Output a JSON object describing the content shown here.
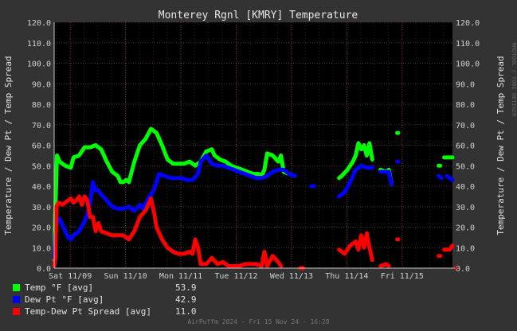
{
  "chart_data": {
    "type": "line",
    "title": "Monterey Rgnl [KMRY] Temperature",
    "ylabel": "Temperature / Dew Pt / Temp Spread",
    "right_ylabel": "Temperature / Dew Pt / Temp Spread",
    "watermark": "RRDTOOL / TOBI OETIKER",
    "ylim": [
      0,
      120
    ],
    "yticks": [
      "0.0",
      "10.0",
      "20.0",
      "30.0",
      "40.0",
      "50.0",
      "60.0",
      "70.0",
      "80.0",
      "90.0",
      "100.0",
      "110.0",
      "120.0"
    ],
    "x_range_days": [
      "Nov 08 17:00",
      "Nov 15 17:00"
    ],
    "xticks": [
      {
        "label": "Sat 11/09",
        "t": 0.29
      },
      {
        "label": "Sun 11/10",
        "t": 1.29
      },
      {
        "label": "Mon 11/11",
        "t": 2.29
      },
      {
        "label": "Tue 11/12",
        "t": 3.29
      },
      {
        "label": "Wed 11/13",
        "t": 4.29
      },
      {
        "label": "Thu 11/14",
        "t": 5.29
      },
      {
        "label": "Fri 11/15",
        "t": 6.29
      }
    ],
    "grid": true,
    "series": [
      {
        "name": "Temp °F [avg]",
        "color": "#00ff00",
        "summary": "53.9",
        "segments": [
          [
            [
              0.0,
              4
            ],
            [
              0.02,
              27
            ],
            [
              0.05,
              55
            ],
            [
              0.1,
              52
            ],
            [
              0.15,
              51
            ],
            [
              0.2,
              50
            ],
            [
              0.3,
              49
            ],
            [
              0.35,
              54
            ],
            [
              0.45,
              55
            ],
            [
              0.55,
              59
            ],
            [
              0.65,
              59
            ],
            [
              0.75,
              60
            ],
            [
              0.85,
              58
            ],
            [
              0.95,
              52
            ],
            [
              1.05,
              47
            ],
            [
              1.15,
              45
            ],
            [
              1.2,
              42
            ],
            [
              1.25,
              42
            ],
            [
              1.3,
              43
            ],
            [
              1.35,
              42
            ],
            [
              1.45,
              52
            ],
            [
              1.55,
              60
            ],
            [
              1.65,
              63
            ],
            [
              1.75,
              68
            ],
            [
              1.85,
              66
            ],
            [
              1.95,
              60
            ],
            [
              2.05,
              53
            ],
            [
              2.15,
              51
            ],
            [
              2.25,
              51
            ],
            [
              2.35,
              51
            ],
            [
              2.45,
              52
            ],
            [
              2.55,
              50
            ],
            [
              2.65,
              52
            ],
            [
              2.75,
              57
            ],
            [
              2.85,
              58
            ],
            [
              2.9,
              55
            ],
            [
              3.0,
              53
            ],
            [
              3.1,
              52
            ],
            [
              3.2,
              50
            ],
            [
              3.3,
              49
            ],
            [
              3.4,
              48
            ],
            [
              3.5,
              47
            ],
            [
              3.6,
              46
            ],
            [
              3.7,
              46
            ],
            [
              3.75,
              45
            ],
            [
              3.8,
              48
            ],
            [
              3.85,
              56
            ],
            [
              3.95,
              55
            ],
            [
              4.05,
              52
            ],
            [
              4.1,
              55
            ],
            [
              4.15,
              47
            ],
            [
              4.25,
              46
            ],
            [
              4.35,
              45
            ]
          ],
          [
            [
              5.15,
              44
            ],
            [
              5.2,
              45
            ],
            [
              5.3,
              48
            ],
            [
              5.4,
              52
            ],
            [
              5.45,
              55
            ],
            [
              5.5,
              61
            ],
            [
              5.55,
              58
            ],
            [
              5.6,
              60
            ],
            [
              5.65,
              55
            ],
            [
              5.7,
              61
            ],
            [
              5.75,
              53
            ]
          ],
          [
            [
              5.9,
              48
            ],
            [
              6.0,
              47
            ],
            [
              6.05,
              48
            ],
            [
              6.1,
              41
            ]
          ],
          [
            [
              6.2,
              66
            ],
            [
              6.22,
              66
            ]
          ],
          [
            [
              6.95,
              50
            ],
            [
              6.98,
              50
            ]
          ],
          [
            [
              7.05,
              54
            ],
            [
              7.2,
              54
            ]
          ]
        ]
      },
      {
        "name": "Dew Pt °F [avg]",
        "color": "#0000ff",
        "summary": "42.9",
        "segments": [
          [
            [
              0.0,
              5
            ],
            [
              0.03,
              20
            ],
            [
              0.05,
              24
            ],
            [
              0.1,
              24
            ],
            [
              0.15,
              21
            ],
            [
              0.2,
              18
            ],
            [
              0.25,
              15
            ],
            [
              0.3,
              14
            ],
            [
              0.35,
              16
            ],
            [
              0.45,
              18
            ],
            [
              0.55,
              23
            ],
            [
              0.6,
              26
            ],
            [
              0.65,
              32
            ],
            [
              0.7,
              42
            ],
            [
              0.75,
              38
            ],
            [
              0.8,
              38
            ],
            [
              0.85,
              36
            ],
            [
              0.95,
              33
            ],
            [
              1.05,
              30
            ],
            [
              1.15,
              29
            ],
            [
              1.25,
              29
            ],
            [
              1.35,
              30
            ],
            [
              1.45,
              28
            ],
            [
              1.55,
              31
            ],
            [
              1.6,
              29
            ],
            [
              1.7,
              34
            ],
            [
              1.8,
              38
            ],
            [
              1.9,
              46
            ],
            [
              2.0,
              45
            ],
            [
              2.1,
              44
            ],
            [
              2.2,
              44
            ],
            [
              2.3,
              44
            ],
            [
              2.4,
              43
            ],
            [
              2.5,
              43
            ],
            [
              2.6,
              46
            ],
            [
              2.65,
              52
            ],
            [
              2.75,
              55
            ],
            [
              2.85,
              51
            ],
            [
              2.95,
              50
            ],
            [
              3.05,
              50
            ],
            [
              3.15,
              49
            ],
            [
              3.25,
              48
            ],
            [
              3.35,
              47
            ],
            [
              3.45,
              46
            ],
            [
              3.55,
              45
            ],
            [
              3.65,
              44
            ],
            [
              3.75,
              44
            ],
            [
              3.85,
              45
            ],
            [
              3.95,
              47
            ],
            [
              4.05,
              48
            ],
            [
              4.15,
              48
            ],
            [
              4.25,
              46
            ],
            [
              4.35,
              45
            ]
          ],
          [
            [
              4.65,
              40
            ],
            [
              4.7,
              40
            ]
          ],
          [
            [
              5.15,
              35
            ],
            [
              5.25,
              37
            ],
            [
              5.35,
              42
            ],
            [
              5.45,
              48
            ],
            [
              5.55,
              50
            ],
            [
              5.65,
              49
            ],
            [
              5.75,
              49
            ]
          ],
          [
            [
              5.9,
              47
            ],
            [
              6.0,
              47
            ],
            [
              6.05,
              47
            ],
            [
              6.1,
              41
            ]
          ],
          [
            [
              6.2,
              52
            ],
            [
              6.22,
              52
            ]
          ],
          [
            [
              6.95,
              45
            ],
            [
              7.0,
              44
            ]
          ],
          [
            [
              7.1,
              45
            ],
            [
              7.2,
              43
            ]
          ]
        ]
      },
      {
        "name": "Temp-Dew Pt Spread [avg]",
        "color": "#ff0000",
        "summary": "11.0",
        "segments": [
          [
            [
              0.0,
              1
            ],
            [
              0.02,
              5
            ],
            [
              0.04,
              30
            ],
            [
              0.08,
              32
            ],
            [
              0.15,
              31
            ],
            [
              0.2,
              32
            ],
            [
              0.25,
              33
            ],
            [
              0.3,
              34
            ],
            [
              0.35,
              32
            ],
            [
              0.4,
              33
            ],
            [
              0.45,
              35
            ],
            [
              0.5,
              31
            ],
            [
              0.55,
              35
            ],
            [
              0.6,
              33
            ],
            [
              0.65,
              25
            ],
            [
              0.7,
              25
            ],
            [
              0.75,
              18
            ],
            [
              0.8,
              22
            ],
            [
              0.85,
              18
            ],
            [
              0.95,
              17
            ],
            [
              1.05,
              16
            ],
            [
              1.15,
              16
            ],
            [
              1.25,
              16
            ],
            [
              1.35,
              14
            ],
            [
              1.45,
              18
            ],
            [
              1.55,
              25
            ],
            [
              1.65,
              28
            ],
            [
              1.75,
              34
            ],
            [
              1.8,
              28
            ],
            [
              1.85,
              20
            ],
            [
              1.95,
              14
            ],
            [
              2.05,
              10
            ],
            [
              2.15,
              8
            ],
            [
              2.25,
              7
            ],
            [
              2.35,
              7
            ],
            [
              2.45,
              8
            ],
            [
              2.5,
              7
            ],
            [
              2.55,
              14
            ],
            [
              2.6,
              10
            ],
            [
              2.65,
              2
            ],
            [
              2.75,
              2
            ],
            [
              2.85,
              5
            ],
            [
              2.95,
              2
            ],
            [
              3.05,
              3
            ],
            [
              3.15,
              1
            ],
            [
              3.25,
              1
            ],
            [
              3.35,
              1
            ],
            [
              3.45,
              2
            ],
            [
              3.55,
              2
            ],
            [
              3.65,
              2
            ],
            [
              3.75,
              1
            ],
            [
              3.8,
              8
            ],
            [
              3.85,
              1
            ],
            [
              3.95,
              6
            ],
            [
              4.05,
              3
            ],
            [
              4.1,
              1
            ]
          ],
          [
            [
              4.45,
              0
            ],
            [
              4.5,
              0
            ]
          ],
          [
            [
              5.15,
              9
            ],
            [
              5.25,
              7
            ],
            [
              5.35,
              11
            ],
            [
              5.45,
              13
            ],
            [
              5.5,
              9
            ],
            [
              5.55,
              16
            ],
            [
              5.6,
              10
            ],
            [
              5.65,
              17
            ],
            [
              5.7,
              10
            ],
            [
              5.75,
              4
            ]
          ],
          [
            [
              5.9,
              1
            ],
            [
              6.0,
              2
            ],
            [
              6.05,
              1
            ]
          ],
          [
            [
              6.2,
              14
            ],
            [
              6.22,
              14
            ]
          ],
          [
            [
              6.95,
              6
            ],
            [
              6.98,
              6
            ]
          ],
          [
            [
              7.05,
              9
            ],
            [
              7.15,
              9
            ],
            [
              7.2,
              11
            ]
          ]
        ]
      }
    ],
    "footer": "AirPuffm 2024 - Fri 15 Nov 24 - 16:28"
  }
}
